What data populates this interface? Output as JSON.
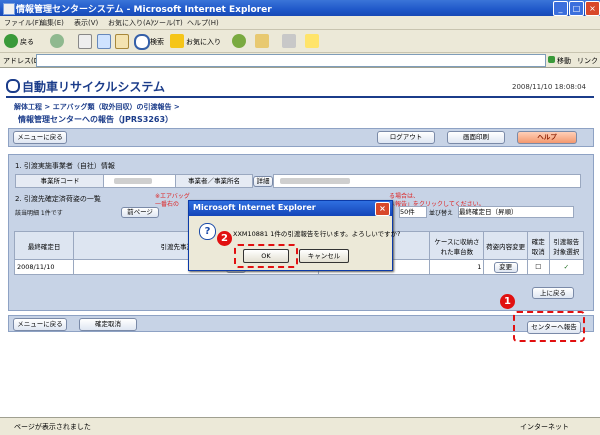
{
  "window": {
    "title": "情報管理センターシステム - Microsoft Internet Explorer",
    "minimize": "_",
    "maximize": "□",
    "close": "×"
  },
  "menu": [
    "ファイル(F)",
    "編集(E)",
    "表示(V)",
    "お気に入り(A)",
    "ツール(T)",
    "ヘルプ(H)"
  ],
  "toolbar": {
    "back": "戻る",
    "search": "検索",
    "favorites": "お気に入り"
  },
  "address": {
    "label": "アドレス(D)",
    "go": "移動",
    "links": "リンク"
  },
  "site": {
    "brand": "自動車リサイクルシステム",
    "datetime": "2008/11/10 18:08:04"
  },
  "breadcrumb": "解体工程 > エアバッグ類（取外回収）の引渡報告 >",
  "page_title": "情報管理センターへの報告（JPRS3263）",
  "top_buttons": {
    "menu": "メニューに戻る",
    "logout": "ログアウト",
    "print": "画面印刷",
    "help": "ヘルプ"
  },
  "section1": {
    "title": "1. 引渡実施事業者（自社）情報",
    "code_label": "事業所コード",
    "name_label": "事業者／事業所名",
    "detail": "詳細"
  },
  "section2": {
    "title": "2. 引渡先確定済荷姿の一覧",
    "note1": "※エアバッグ",
    "note2": "一番右の",
    "note3": "る場合は、",
    "note4": "へ報告」をクリックしてください。",
    "count": "該当明細 1件です",
    "prev": "前ページ",
    "per_page": "50件",
    "sort_label": "並び替え",
    "sort_value": "最終確定日（昇順）",
    "columns": [
      "最終確定日",
      "引渡先事業者／事業所名",
      "ケースに収納された車台数",
      "荷姿内容変更",
      "確定取消",
      "引渡報告対象選択"
    ],
    "row": {
      "date": "2008/11/10",
      "detail": "詳細",
      "count": "1",
      "change": "変更",
      "check": "✓"
    },
    "to_top": "上に戻る"
  },
  "bottom_buttons": {
    "menu": "メニューに戻る",
    "cancel": "確定取消",
    "report": "センターへ報告"
  },
  "dialog": {
    "title": "Microsoft Internet Explorer",
    "message": "XXM10881 1件の引渡報告を行います。よろしいですか?",
    "ok": "OK",
    "cancel": "キャンセル",
    "icon": "?"
  },
  "markers": {
    "one": "1",
    "two": "2"
  },
  "status": {
    "left": "ページが表示されました",
    "zone": "インターネット"
  }
}
